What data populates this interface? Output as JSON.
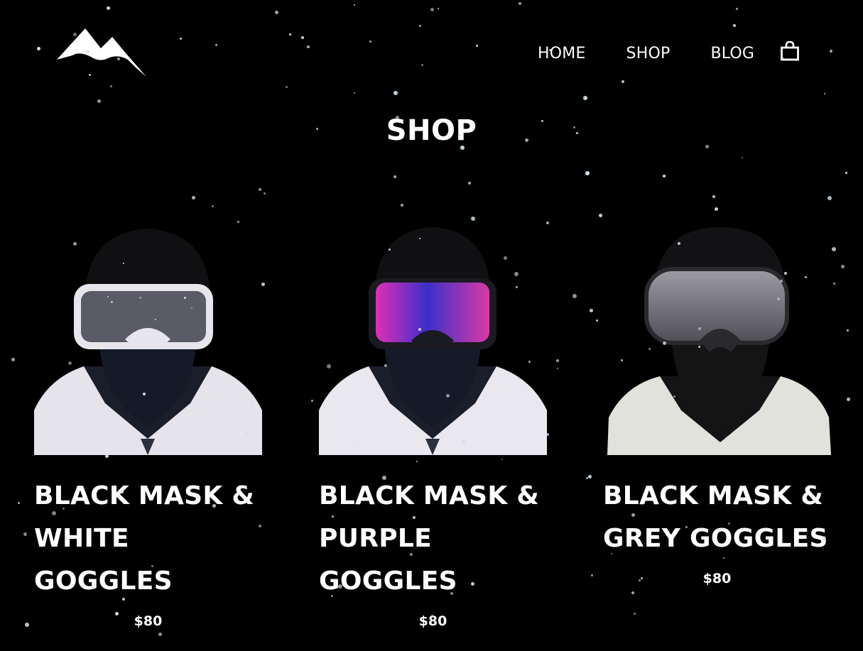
{
  "header": {
    "logo_icon": "mountain-logo-icon",
    "nav": [
      {
        "label": "HOME"
      },
      {
        "label": "SHOP"
      },
      {
        "label": "BLOG"
      }
    ],
    "cart_icon": "shopping-bag-icon"
  },
  "page": {
    "title": "SHOP"
  },
  "products": [
    {
      "name_lines": [
        "BLACK MASK &",
        "WHITE",
        "GOGGLES"
      ],
      "price": "$80",
      "goggle_color": "white"
    },
    {
      "name_lines": [
        "BLACK MASK &",
        "PURPLE",
        "GOGGLES"
      ],
      "price": "$80",
      "goggle_color": "purple"
    },
    {
      "name_lines": [
        "BLACK MASK &",
        "GREY GOGGLES"
      ],
      "price": "$80",
      "goggle_color": "grey"
    }
  ],
  "colors": {
    "background": "#000000",
    "text": "#ffffff",
    "snow": "#cfe0ea"
  }
}
